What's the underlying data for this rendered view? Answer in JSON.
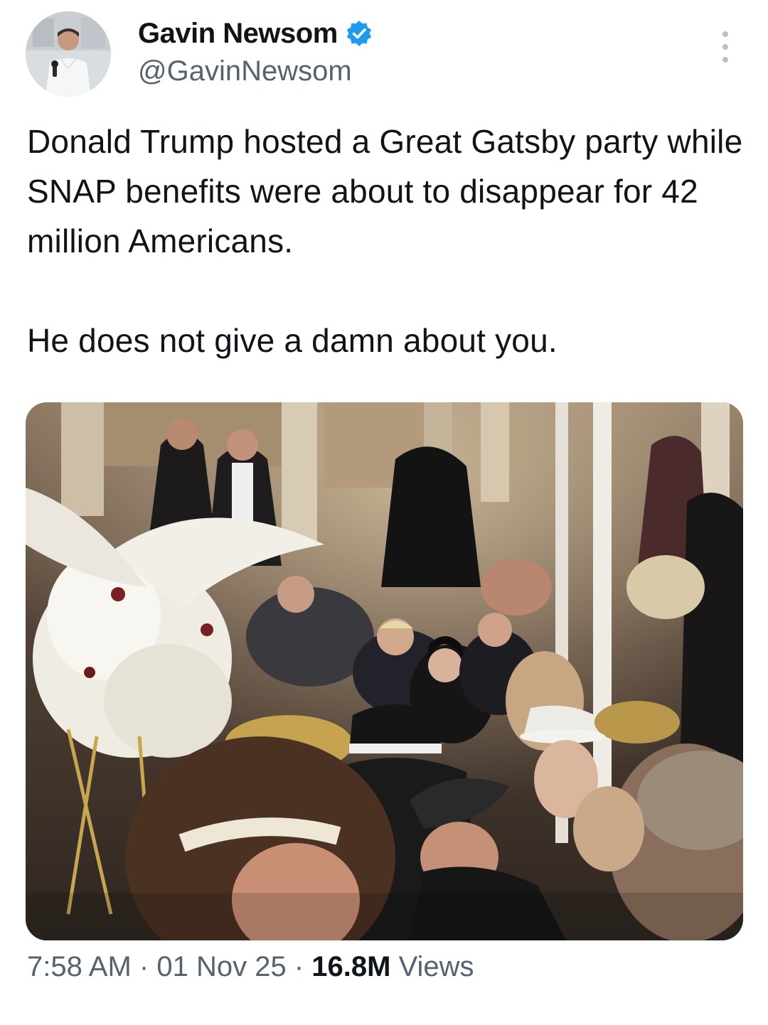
{
  "author": {
    "display_name": "Gavin Newsom",
    "handle": "@GavinNewsom",
    "verified": true,
    "verified_color": "#1d9bf0"
  },
  "tweet": {
    "paragraphs": [
      "Donald Trump hosted a Great Gatsby party while SNAP benefits were about to disappear for 42 million Americans.",
      "He does not give a damn about you."
    ]
  },
  "media": {
    "type": "photo"
  },
  "meta": {
    "time": "7:58 AM",
    "separator": "·",
    "date": "01 Nov 25",
    "views_count": "16.8M",
    "views_label": "Views"
  },
  "icons": {
    "more": "more-icon",
    "verified": "verified-badge-icon"
  }
}
